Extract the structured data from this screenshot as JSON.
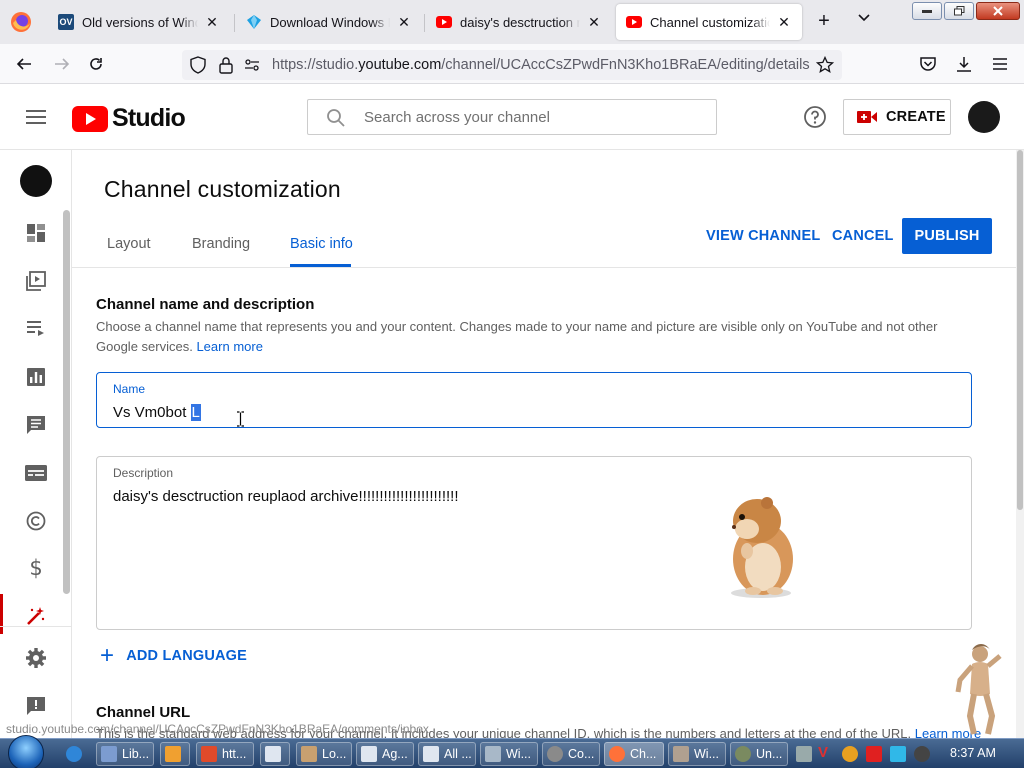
{
  "browser": {
    "tabs": [
      {
        "title": "Old versions of Windows",
        "favicon": "ov-favicon",
        "favicon_text": "OV"
      },
      {
        "title": "Download Windows Mov",
        "favicon": "diamond-favicon"
      },
      {
        "title": "daisy's desctruction reupl",
        "favicon": "youtube-favicon"
      },
      {
        "title": "Channel customization -",
        "favicon": "youtube-favicon",
        "active": true
      }
    ],
    "url_prefix": "https://studio.",
    "url_domain": "youtube.com",
    "url_path": "/channel/UCAccCsZPwdFnN3Kho1BRaEA/editing/details"
  },
  "studio": {
    "logo_text": "Studio",
    "search_placeholder": "Search across your channel",
    "create_label": "CREATE"
  },
  "page": {
    "title": "Channel customization",
    "tabs": [
      {
        "label": "Layout"
      },
      {
        "label": "Branding"
      },
      {
        "label": "Basic info",
        "active": true
      }
    ],
    "view_channel_label": "VIEW CHANNEL",
    "cancel_label": "CANCEL",
    "publish_label": "PUBLISH"
  },
  "basic_info": {
    "section_title": "Channel name and description",
    "section_desc": "Choose a channel name that represents you and your content. Changes made to your name and picture are visible only on YouTube and not other Google services.",
    "learn_more": "Learn more",
    "name_label": "Name",
    "name_value": "Vs Vm0bot",
    "name_selected": "L",
    "description_label": "Description",
    "description_value": "daisy's desctruction reuplaod archive!!!!!!!!!!!!!!!!!!!!!!!!",
    "add_language": "ADD LANGUAGE",
    "url_section_title": "Channel URL",
    "url_desc": "This is the standard web address for your channel. It includes your unique channel ID, which is the numbers and letters at the end of the URL.",
    "url_learn_more": "Learn more"
  },
  "status_bar": "studio.youtube.com/channel/UCAccCsZPwdFnN3Kho1BRaEA/comments/inbox",
  "taskbar": {
    "items": [
      {
        "label": "Lib..."
      },
      {
        "label": ""
      },
      {
        "label": "htt..."
      },
      {
        "label": ""
      },
      {
        "label": "Lo..."
      },
      {
        "label": "Ag..."
      },
      {
        "label": "All ..."
      },
      {
        "label": "Wi..."
      },
      {
        "label": "Co..."
      },
      {
        "label": "Ch...",
        "active": true
      },
      {
        "label": "Wi..."
      },
      {
        "label": "Un..."
      }
    ],
    "clock": "8:37 AM"
  },
  "colors": {
    "accent": "#065fd4",
    "youtube_red": "#ff0000",
    "selection": "#3375e4"
  }
}
